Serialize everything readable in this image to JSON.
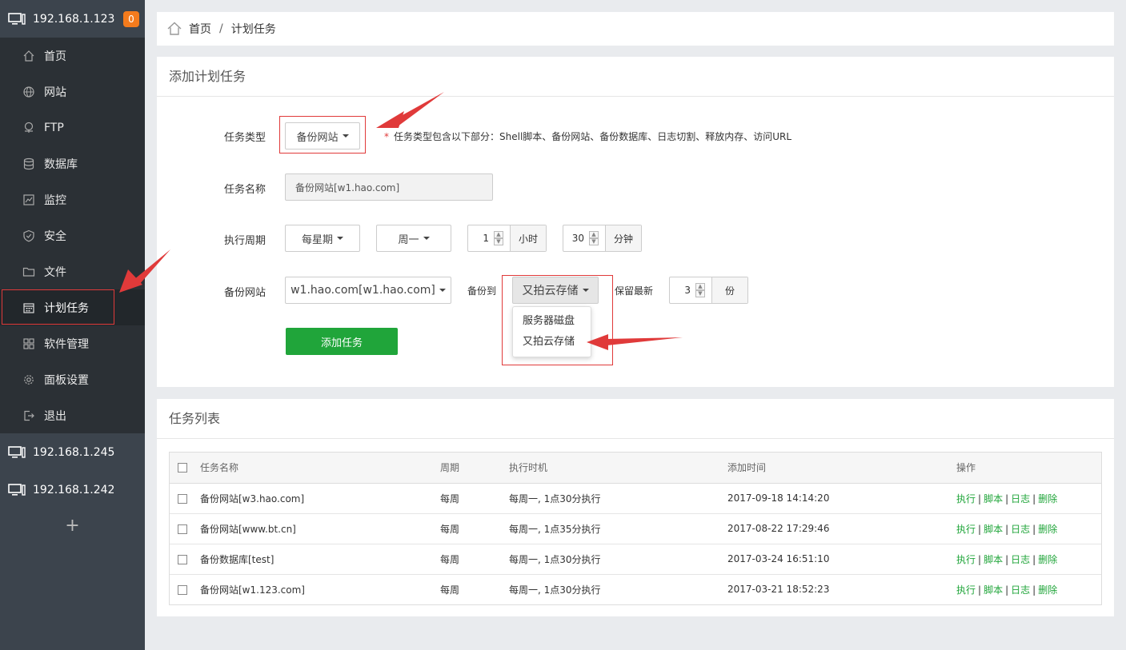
{
  "sidebar": {
    "current_server": "192.168.1.123",
    "badge": "0",
    "items": [
      {
        "label": "首页",
        "icon": "home-icon"
      },
      {
        "label": "网站",
        "icon": "globe-icon"
      },
      {
        "label": "FTP",
        "icon": "ftp-icon"
      },
      {
        "label": "数据库",
        "icon": "database-icon"
      },
      {
        "label": "监控",
        "icon": "monitor-chart-icon"
      },
      {
        "label": "安全",
        "icon": "shield-icon"
      },
      {
        "label": "文件",
        "icon": "folder-icon"
      },
      {
        "label": "计划任务",
        "icon": "calendar-icon"
      },
      {
        "label": "软件管理",
        "icon": "grid-apps-icon"
      },
      {
        "label": "面板设置",
        "icon": "gear-icon"
      },
      {
        "label": "退出",
        "icon": "logout-icon"
      }
    ],
    "other_servers": [
      "192.168.1.245",
      "192.168.1.242"
    ],
    "add_label": "+"
  },
  "breadcrumb": {
    "home": "首页",
    "sep": "/",
    "current": "计划任务"
  },
  "form": {
    "title": "添加计划任务",
    "task_type_label": "任务类型",
    "task_type_value": "备份网站",
    "task_type_hint_mark": "*",
    "task_type_hint": "任务类型包含以下部分：Shell脚本、备份网站、备份数据库、日志切割、释放内存、访问URL",
    "task_name_label": "任务名称",
    "task_name_placeholder": "备份网站[w1.hao.com]",
    "cycle_label": "执行周期",
    "cycle_value": "每星期",
    "weekday_value": "周一",
    "hour_value": "1",
    "hour_unit": "小时",
    "minute_value": "30",
    "minute_unit": "分钟",
    "backup_site_label": "备份网站",
    "backup_site_value": "w1.hao.com[w1.hao.com]",
    "backup_to_label": "备份到",
    "backup_to_value": "又拍云存储",
    "backup_to_options": [
      "服务器磁盘",
      "又拍云存储"
    ],
    "keep_label": "保留最新",
    "keep_value": "3",
    "keep_unit": "份",
    "submit_label": "添加任务"
  },
  "task_list": {
    "title": "任务列表",
    "columns": [
      "任务名称",
      "周期",
      "执行时机",
      "添加时间",
      "操作"
    ],
    "rows": [
      {
        "name": "备份网站[w3.hao.com]",
        "cycle": "每周",
        "when": "每周一, 1点30分执行",
        "added": "2017-09-18 14:14:20"
      },
      {
        "name": "备份网站[www.bt.cn]",
        "cycle": "每周",
        "when": "每周一, 1点35分执行",
        "added": "2017-08-22 17:29:46"
      },
      {
        "name": "备份数据库[test]",
        "cycle": "每周",
        "when": "每周一, 1点30分执行",
        "added": "2017-03-24 16:51:10"
      },
      {
        "name": "备份网站[w1.123.com]",
        "cycle": "每周",
        "when": "每周一, 1点30分执行",
        "added": "2017-03-21 18:52:23"
      }
    ],
    "actions": [
      "执行",
      "脚本",
      "日志",
      "删除"
    ],
    "action_sep": "|"
  },
  "colors": {
    "accent": "#20a53a",
    "sidebar": "#3c444d",
    "menu": "#2b3035",
    "badge": "#f37b1d",
    "annotation": "#e03a3a"
  }
}
